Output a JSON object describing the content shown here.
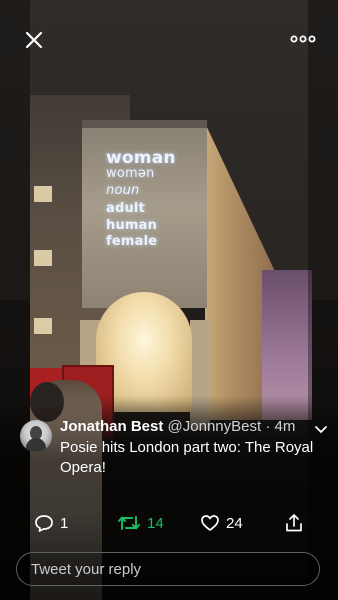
{
  "projection": [
    "woman",
    "womən",
    "noun",
    "adult",
    "human",
    "female"
  ],
  "tweet": {
    "author_name": "Jonathan Best",
    "author_handle": "@JonnnyBest",
    "time": "· 4m",
    "text": "Posie hits London part two: The Royal Opera!"
  },
  "actions": {
    "reply_count": "1",
    "retweet_count": "14",
    "like_count": "24"
  },
  "reply": {
    "placeholder": "Tweet your reply"
  },
  "colors": {
    "retweet": "#17bf63",
    "background": "#000000"
  },
  "icons": {
    "close": "close-icon",
    "more": "more-horizontal-icon",
    "chevron": "chevron-down-icon",
    "reply": "reply-icon",
    "retweet": "retweet-icon",
    "like": "heart-icon",
    "share": "share-icon"
  }
}
